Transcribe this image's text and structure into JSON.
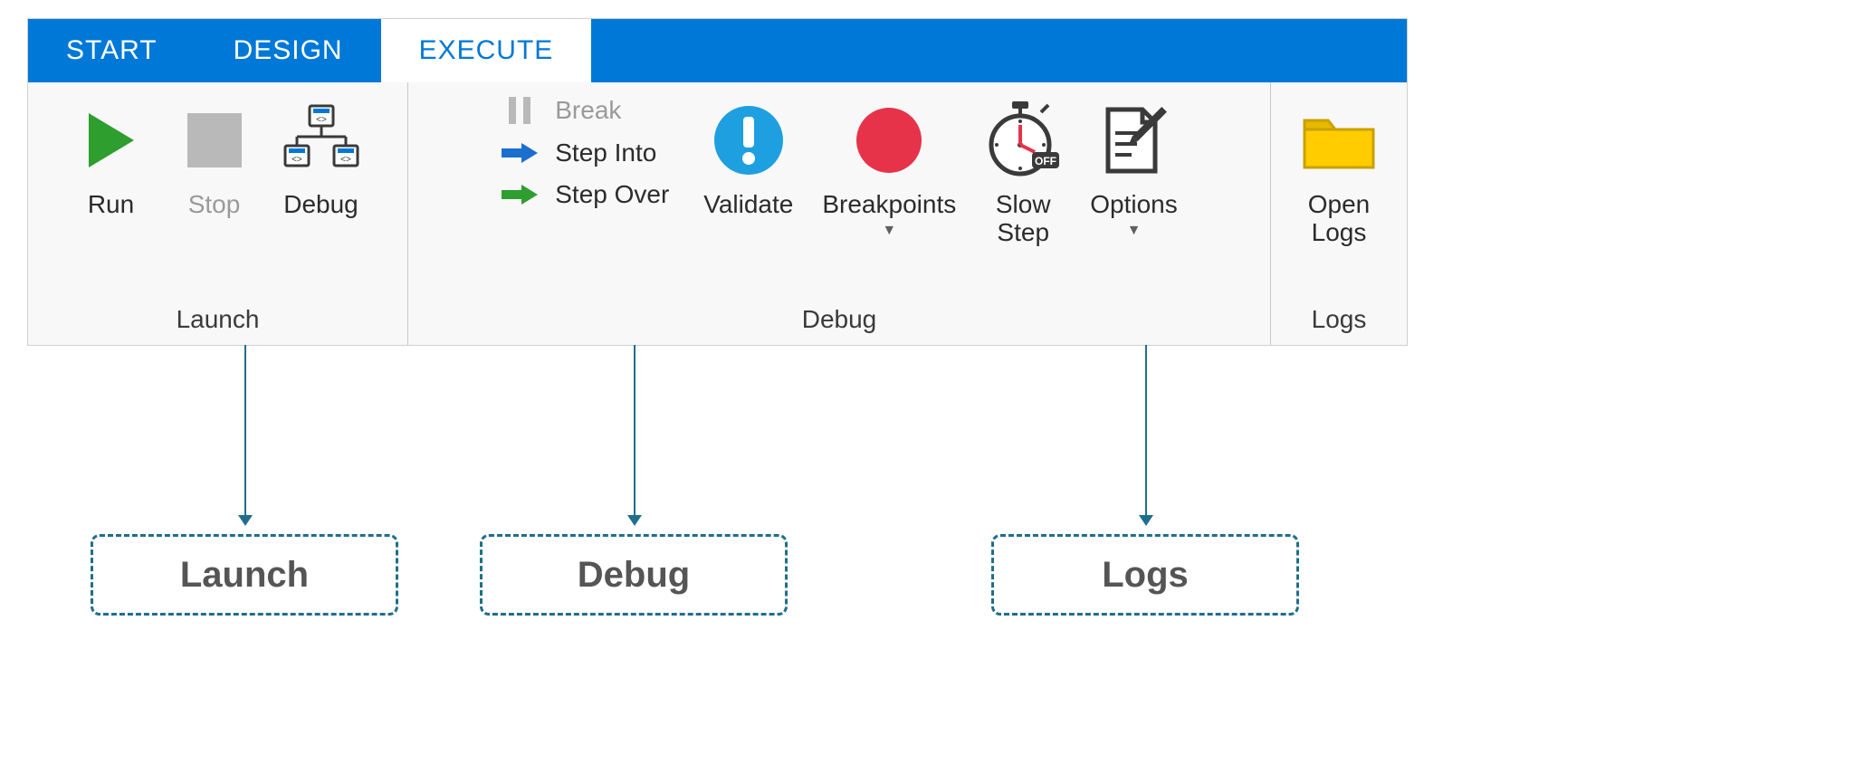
{
  "tabs": {
    "start": "START",
    "design": "DESIGN",
    "execute": "EXECUTE"
  },
  "groups": {
    "launch": {
      "label": "Launch",
      "run": "Run",
      "stop": "Stop",
      "debug": "Debug"
    },
    "debug": {
      "label": "Debug",
      "break": "Break",
      "step_into": "Step Into",
      "step_over": "Step Over",
      "validate": "Validate",
      "breakpoints": "Breakpoints",
      "slow_step": "Slow\nStep",
      "options": "Options"
    },
    "logs": {
      "label": "Logs",
      "open_logs": "Open\nLogs"
    }
  },
  "callouts": {
    "launch": "Launch",
    "debug": "Debug",
    "logs": "Logs"
  },
  "colors": {
    "primary": "#0078d7",
    "green": "#2e9e2e",
    "red": "#e6334a",
    "blue_arrow": "#1a6fcf",
    "callout": "#1f6e8c",
    "yellow": "#ffcc00"
  }
}
